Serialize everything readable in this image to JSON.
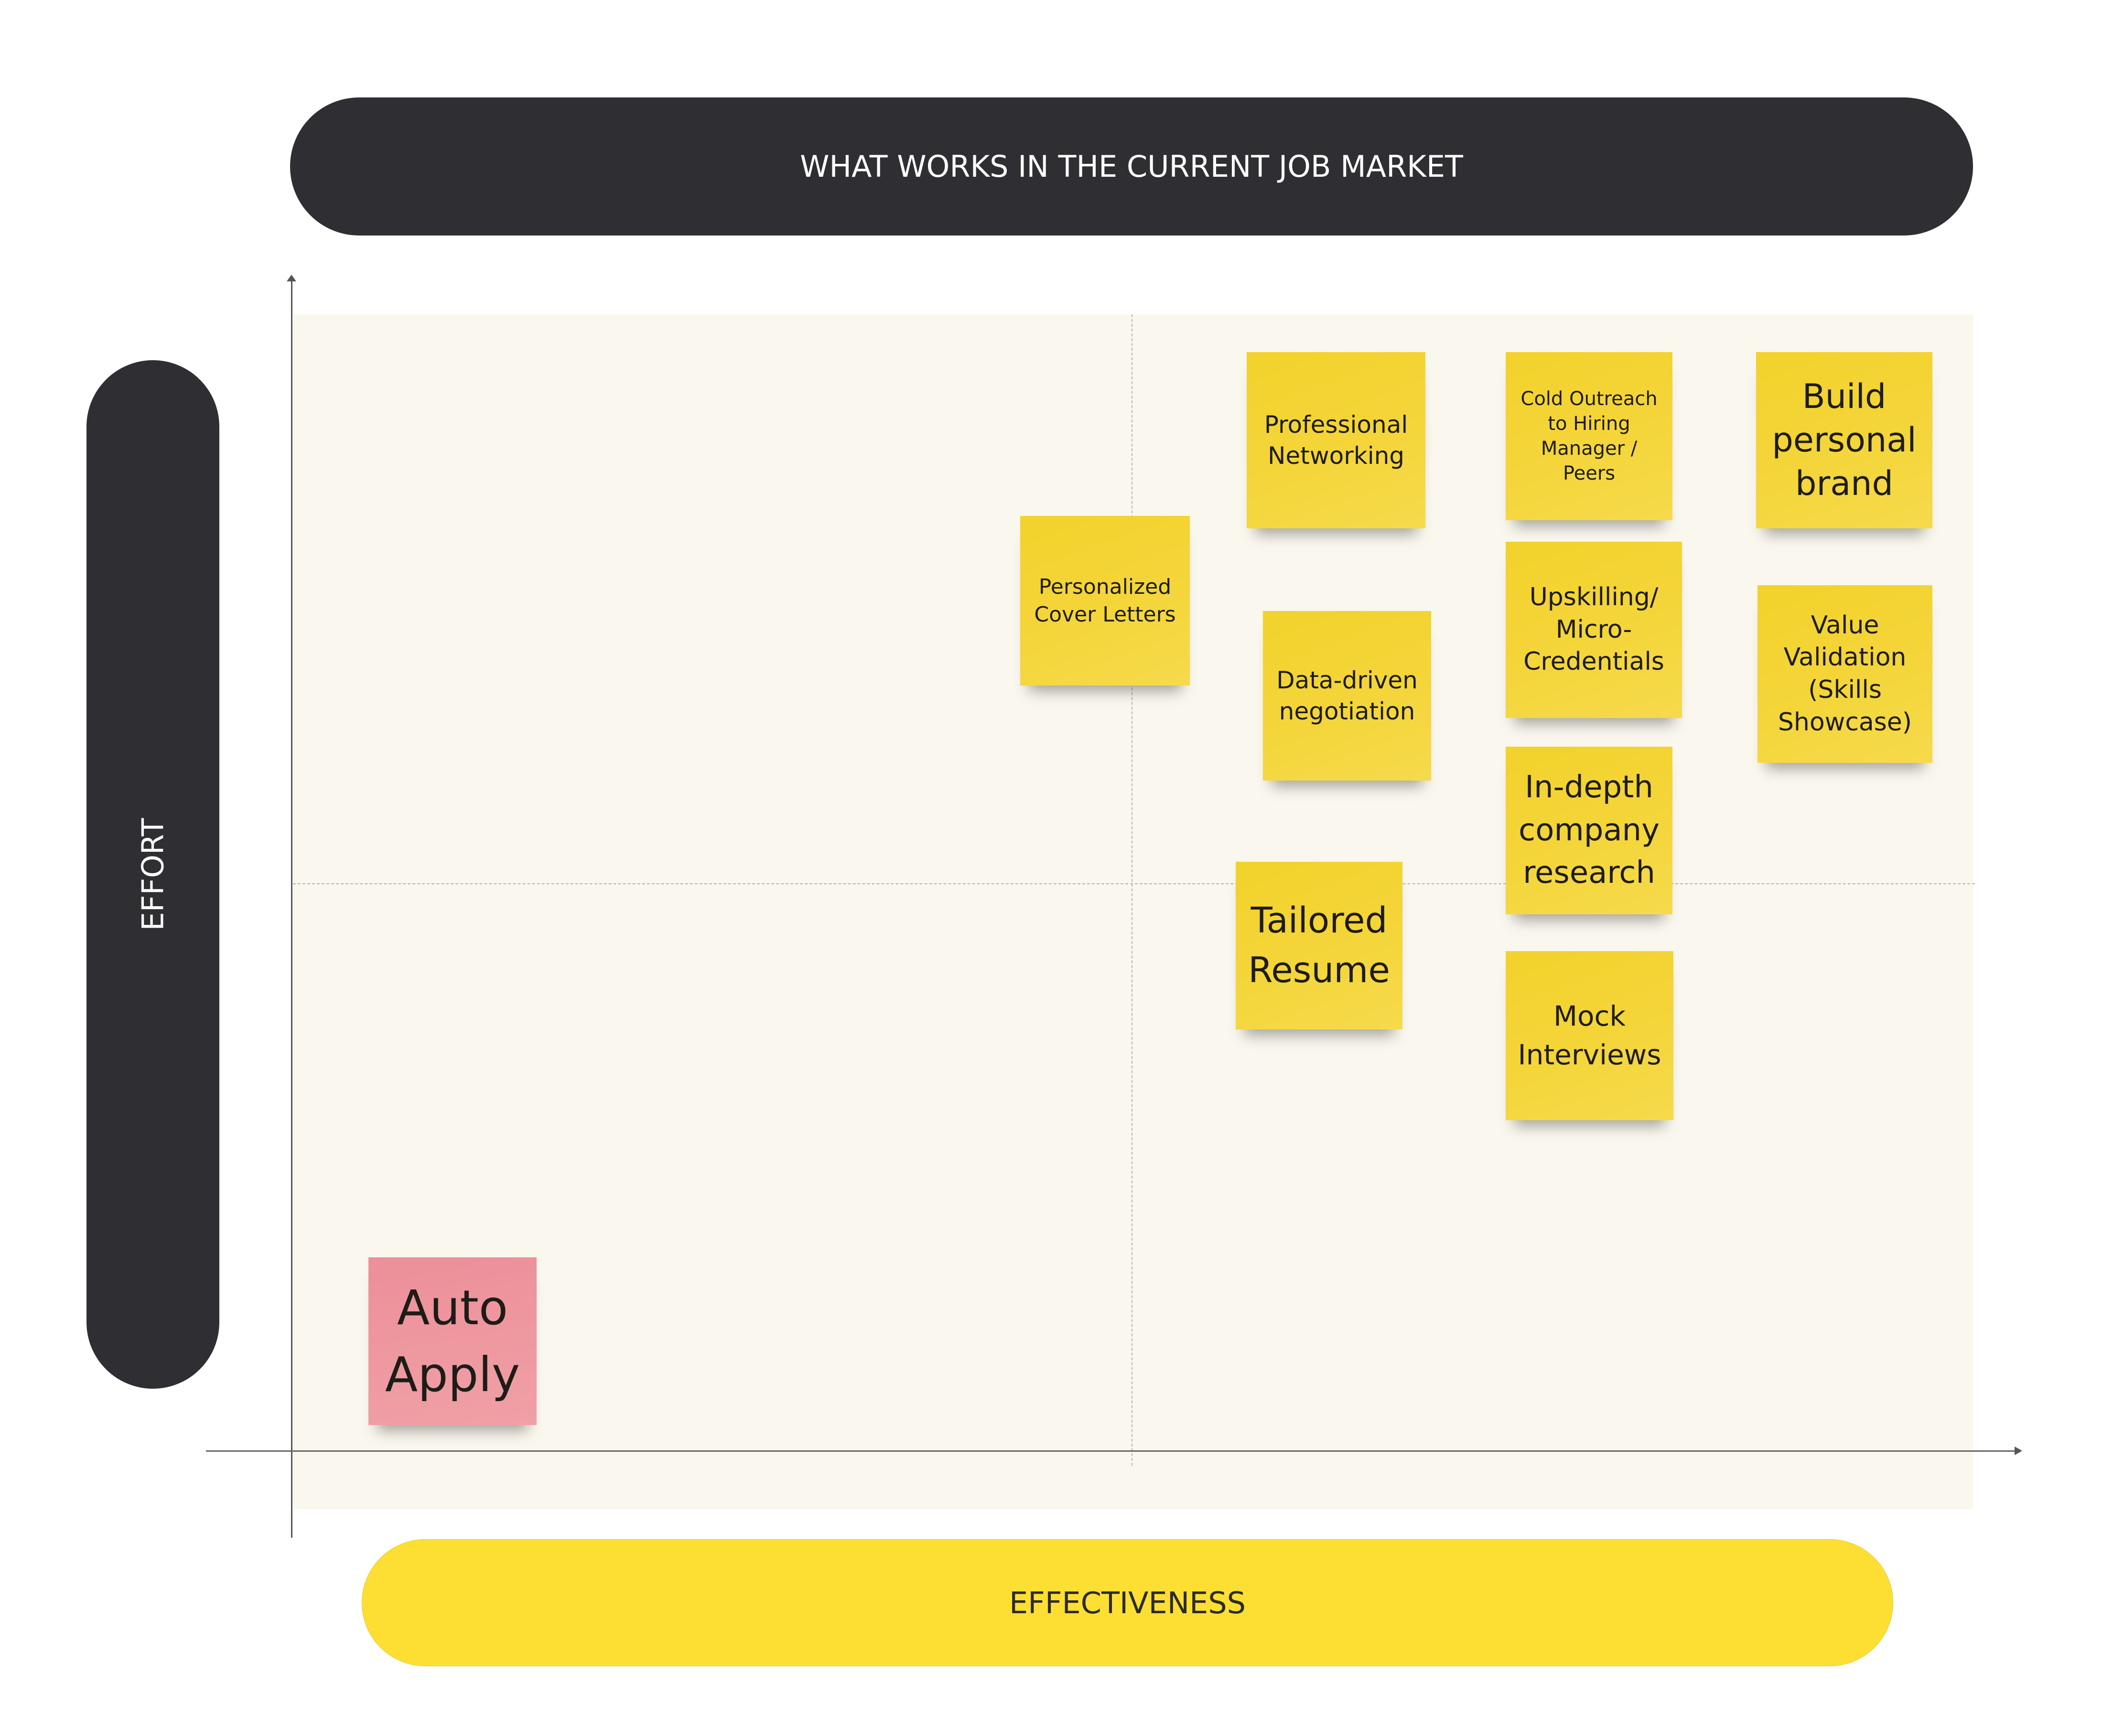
{
  "title": "WHAT WORKS IN THE CURRENT JOB MARKET",
  "axes": {
    "y_label": "EFFORT",
    "x_label": "EFFECTIVENESS"
  },
  "colors": {
    "dark_pill": "#2f2e33",
    "effectiveness_pill": "#fddf34",
    "board_background": "#faf7ee",
    "sticky_yellow": "#f4d53a",
    "sticky_pink": "#ee98a0"
  },
  "notes": [
    {
      "id": "personalized-cover-letters",
      "text": "Personalized\nCover Letters",
      "color": "yellow"
    },
    {
      "id": "professional-networking",
      "text": "Professional\nNetworking",
      "color": "yellow"
    },
    {
      "id": "cold-outreach",
      "text": "Cold Outreach\nto Hiring\nManager /\nPeers",
      "color": "yellow"
    },
    {
      "id": "build-personal-brand",
      "text": "Build\npersonal\nbrand",
      "color": "yellow"
    },
    {
      "id": "data-driven-negotiation",
      "text": "Data-driven\nnegotiation",
      "color": "yellow"
    },
    {
      "id": "upskilling",
      "text": "Upskilling/\nMicro-\nCredentials",
      "color": "yellow"
    },
    {
      "id": "value-validation",
      "text": "Value\nValidation\n(Skills\nShowcase)",
      "color": "yellow"
    },
    {
      "id": "in-depth-company-research",
      "text": "In-depth\ncompany\nresearch",
      "color": "yellow"
    },
    {
      "id": "tailored-resume",
      "text": "Tailored\nResume",
      "color": "yellow"
    },
    {
      "id": "mock-interviews",
      "text": "Mock\nInterviews",
      "color": "yellow"
    },
    {
      "id": "auto-apply",
      "text": "Auto\nApply",
      "color": "pink"
    }
  ]
}
